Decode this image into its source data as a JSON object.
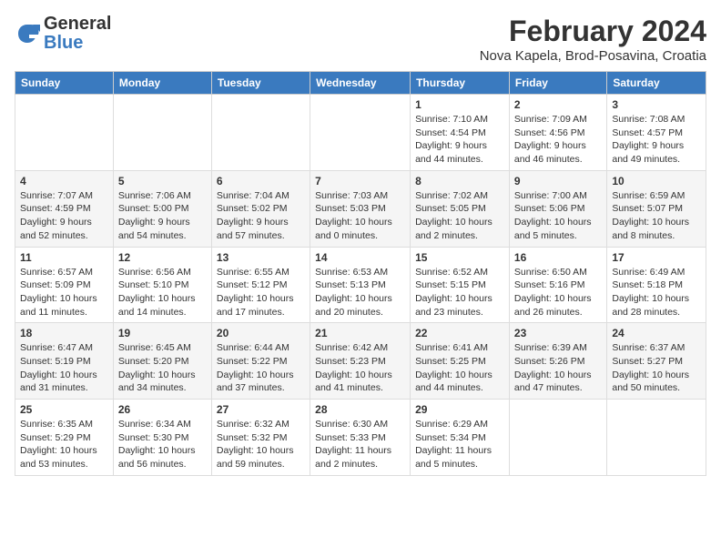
{
  "logo": {
    "general": "General",
    "blue": "Blue"
  },
  "title": "February 2024",
  "subtitle": "Nova Kapela, Brod-Posavina, Croatia",
  "days_of_week": [
    "Sunday",
    "Monday",
    "Tuesday",
    "Wednesday",
    "Thursday",
    "Friday",
    "Saturday"
  ],
  "weeks": [
    [
      {
        "day": "",
        "info": ""
      },
      {
        "day": "",
        "info": ""
      },
      {
        "day": "",
        "info": ""
      },
      {
        "day": "",
        "info": ""
      },
      {
        "day": "1",
        "info": "Sunrise: 7:10 AM\nSunset: 4:54 PM\nDaylight: 9 hours\nand 44 minutes."
      },
      {
        "day": "2",
        "info": "Sunrise: 7:09 AM\nSunset: 4:56 PM\nDaylight: 9 hours\nand 46 minutes."
      },
      {
        "day": "3",
        "info": "Sunrise: 7:08 AM\nSunset: 4:57 PM\nDaylight: 9 hours\nand 49 minutes."
      }
    ],
    [
      {
        "day": "4",
        "info": "Sunrise: 7:07 AM\nSunset: 4:59 PM\nDaylight: 9 hours\nand 52 minutes."
      },
      {
        "day": "5",
        "info": "Sunrise: 7:06 AM\nSunset: 5:00 PM\nDaylight: 9 hours\nand 54 minutes."
      },
      {
        "day": "6",
        "info": "Sunrise: 7:04 AM\nSunset: 5:02 PM\nDaylight: 9 hours\nand 57 minutes."
      },
      {
        "day": "7",
        "info": "Sunrise: 7:03 AM\nSunset: 5:03 PM\nDaylight: 10 hours\nand 0 minutes."
      },
      {
        "day": "8",
        "info": "Sunrise: 7:02 AM\nSunset: 5:05 PM\nDaylight: 10 hours\nand 2 minutes."
      },
      {
        "day": "9",
        "info": "Sunrise: 7:00 AM\nSunset: 5:06 PM\nDaylight: 10 hours\nand 5 minutes."
      },
      {
        "day": "10",
        "info": "Sunrise: 6:59 AM\nSunset: 5:07 PM\nDaylight: 10 hours\nand 8 minutes."
      }
    ],
    [
      {
        "day": "11",
        "info": "Sunrise: 6:57 AM\nSunset: 5:09 PM\nDaylight: 10 hours\nand 11 minutes."
      },
      {
        "day": "12",
        "info": "Sunrise: 6:56 AM\nSunset: 5:10 PM\nDaylight: 10 hours\nand 14 minutes."
      },
      {
        "day": "13",
        "info": "Sunrise: 6:55 AM\nSunset: 5:12 PM\nDaylight: 10 hours\nand 17 minutes."
      },
      {
        "day": "14",
        "info": "Sunrise: 6:53 AM\nSunset: 5:13 PM\nDaylight: 10 hours\nand 20 minutes."
      },
      {
        "day": "15",
        "info": "Sunrise: 6:52 AM\nSunset: 5:15 PM\nDaylight: 10 hours\nand 23 minutes."
      },
      {
        "day": "16",
        "info": "Sunrise: 6:50 AM\nSunset: 5:16 PM\nDaylight: 10 hours\nand 26 minutes."
      },
      {
        "day": "17",
        "info": "Sunrise: 6:49 AM\nSunset: 5:18 PM\nDaylight: 10 hours\nand 28 minutes."
      }
    ],
    [
      {
        "day": "18",
        "info": "Sunrise: 6:47 AM\nSunset: 5:19 PM\nDaylight: 10 hours\nand 31 minutes."
      },
      {
        "day": "19",
        "info": "Sunrise: 6:45 AM\nSunset: 5:20 PM\nDaylight: 10 hours\nand 34 minutes."
      },
      {
        "day": "20",
        "info": "Sunrise: 6:44 AM\nSunset: 5:22 PM\nDaylight: 10 hours\nand 37 minutes."
      },
      {
        "day": "21",
        "info": "Sunrise: 6:42 AM\nSunset: 5:23 PM\nDaylight: 10 hours\nand 41 minutes."
      },
      {
        "day": "22",
        "info": "Sunrise: 6:41 AM\nSunset: 5:25 PM\nDaylight: 10 hours\nand 44 minutes."
      },
      {
        "day": "23",
        "info": "Sunrise: 6:39 AM\nSunset: 5:26 PM\nDaylight: 10 hours\nand 47 minutes."
      },
      {
        "day": "24",
        "info": "Sunrise: 6:37 AM\nSunset: 5:27 PM\nDaylight: 10 hours\nand 50 minutes."
      }
    ],
    [
      {
        "day": "25",
        "info": "Sunrise: 6:35 AM\nSunset: 5:29 PM\nDaylight: 10 hours\nand 53 minutes."
      },
      {
        "day": "26",
        "info": "Sunrise: 6:34 AM\nSunset: 5:30 PM\nDaylight: 10 hours\nand 56 minutes."
      },
      {
        "day": "27",
        "info": "Sunrise: 6:32 AM\nSunset: 5:32 PM\nDaylight: 10 hours\nand 59 minutes."
      },
      {
        "day": "28",
        "info": "Sunrise: 6:30 AM\nSunset: 5:33 PM\nDaylight: 11 hours\nand 2 minutes."
      },
      {
        "day": "29",
        "info": "Sunrise: 6:29 AM\nSunset: 5:34 PM\nDaylight: 11 hours\nand 5 minutes."
      },
      {
        "day": "",
        "info": ""
      },
      {
        "day": "",
        "info": ""
      }
    ]
  ]
}
